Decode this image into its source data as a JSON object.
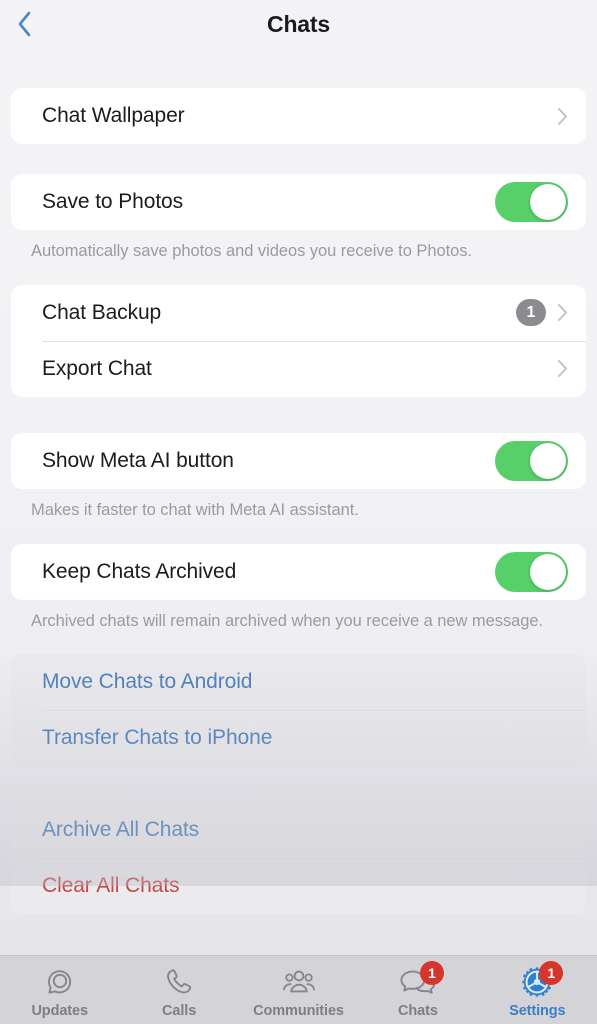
{
  "header": {
    "title": "Chats",
    "back_icon": "chevron-left-icon"
  },
  "colors": {
    "accent_blue": "#4a7ebb",
    "destructive_red": "#c24a46",
    "toggle_on_green": "#57d06a",
    "badge_gray": "#8b8b90",
    "badge_red": "#d6352b",
    "page_background": "#f2f2f5",
    "card_background": "#ffffff",
    "tabbar_background": "#d4d4d8",
    "active_tab_blue": "#3b7fc4"
  },
  "sections": [
    {
      "id": "wallpaper",
      "rows": [
        {
          "label": "Chat Wallpaper",
          "type": "disclosure",
          "accessory_icon": "chevron-right-icon"
        }
      ],
      "note": ""
    },
    {
      "id": "save-to-photos",
      "rows": [
        {
          "label": "Save to Photos",
          "type": "toggle",
          "toggle_on": true
        }
      ],
      "note": "Automatically save photos and videos you receive to Photos."
    },
    {
      "id": "backup-export",
      "rows": [
        {
          "label": "Chat Backup",
          "type": "disclosure",
          "badge": "1",
          "accessory_icon": "chevron-right-icon"
        },
        {
          "label": "Export Chat",
          "type": "disclosure",
          "accessory_icon": "chevron-right-icon"
        }
      ],
      "note": ""
    },
    {
      "id": "meta-ai",
      "rows": [
        {
          "label": "Show Meta AI button",
          "type": "toggle",
          "toggle_on": true
        }
      ],
      "note": "Makes it faster to chat with Meta AI assistant."
    },
    {
      "id": "keep-archived",
      "rows": [
        {
          "label": "Keep Chats Archived",
          "type": "toggle",
          "toggle_on": true
        }
      ],
      "note": "Archived chats will remain archived when you receive a new message."
    },
    {
      "id": "transfer",
      "rows": [
        {
          "label": "Move Chats to Android",
          "type": "link"
        },
        {
          "label": "Transfer Chats to iPhone",
          "type": "link"
        }
      ],
      "note": ""
    },
    {
      "id": "bulk-actions",
      "rows": [
        {
          "label": "Archive All Chats",
          "type": "link"
        },
        {
          "label": "Clear All Chats",
          "type": "destructive"
        }
      ],
      "note": ""
    }
  ],
  "tab_bar": {
    "tabs": [
      {
        "label": "Updates",
        "icon": "updates-status-icon",
        "active": false,
        "badge": ""
      },
      {
        "label": "Calls",
        "icon": "phone-handset-icon",
        "active": false,
        "badge": ""
      },
      {
        "label": "Communities",
        "icon": "communities-people-icon",
        "active": false,
        "badge": ""
      },
      {
        "label": "Chats",
        "icon": "chat-bubbles-icon",
        "active": false,
        "badge": "1"
      },
      {
        "label": "Settings",
        "icon": "gear-icon",
        "active": true,
        "badge": "1"
      }
    ]
  }
}
